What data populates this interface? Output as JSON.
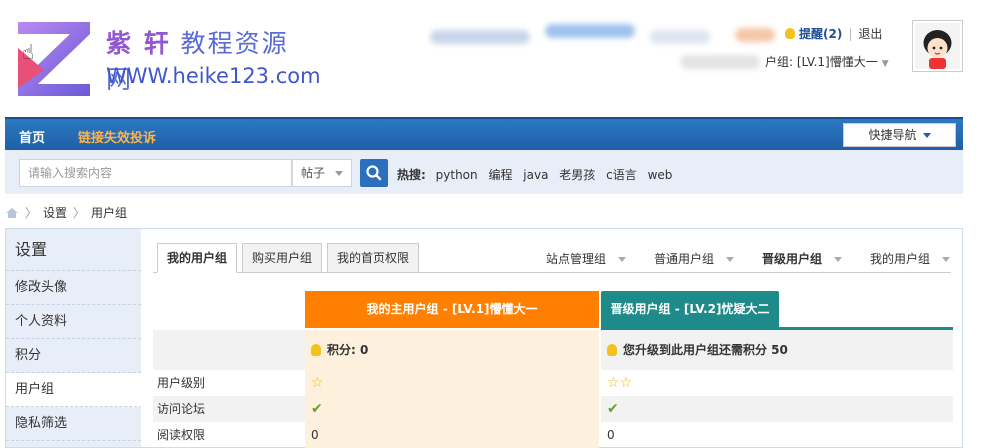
{
  "site": {
    "logo_title_bold": "紫 轩",
    "logo_title_rest": "教程资源网",
    "logo_url": "WWW.heike123.com"
  },
  "user_nav": {
    "remind": "提醒(2)",
    "logout": "退出",
    "group_label": "户组: [LV.1]懵懂大一"
  },
  "nav": {
    "home": "首页",
    "report": "链接失效投诉",
    "quick_nav": "快捷导航"
  },
  "search": {
    "placeholder": "请输入搜索内容",
    "type": "帖子",
    "hot_label": "热搜:",
    "hot_terms": [
      "python",
      "编程",
      "java",
      "老男孩",
      "c语言",
      "web"
    ]
  },
  "breadcrumb": {
    "items": [
      "设置",
      "用户组"
    ]
  },
  "sidebar": {
    "title": "设置",
    "items": [
      {
        "label": "修改头像"
      },
      {
        "label": "个人资料"
      },
      {
        "label": "积分"
      },
      {
        "label": "用户组"
      },
      {
        "label": "隐私筛选"
      }
    ],
    "active": "用户组"
  },
  "tabs": [
    {
      "label": "我的用户组"
    },
    {
      "label": "购买用户组"
    },
    {
      "label": "我的首页权限"
    }
  ],
  "group_nav": {
    "items": [
      "站点管理组",
      "普通用户组",
      "晋级用户组",
      "我的用户组"
    ]
  },
  "compare": {
    "my_group": "我的主用户组 - [LV.1]懵懂大一",
    "up_group": "晋级用户组 - [LV.2]忧疑大二",
    "my_score": "积分: 0",
    "up_score": "您升级到此用户组还需积分 50",
    "rows": [
      {
        "label": "用户级别",
        "mine_stars": 1,
        "up_stars": 2
      },
      {
        "label": "访问论坛"
      },
      {
        "label": "阅读权限",
        "mine": "0",
        "up": "0"
      }
    ]
  },
  "colors": {
    "nav_blue": "#1f5fa6",
    "orange": "#ff8000",
    "teal": "#1e8a8a"
  }
}
